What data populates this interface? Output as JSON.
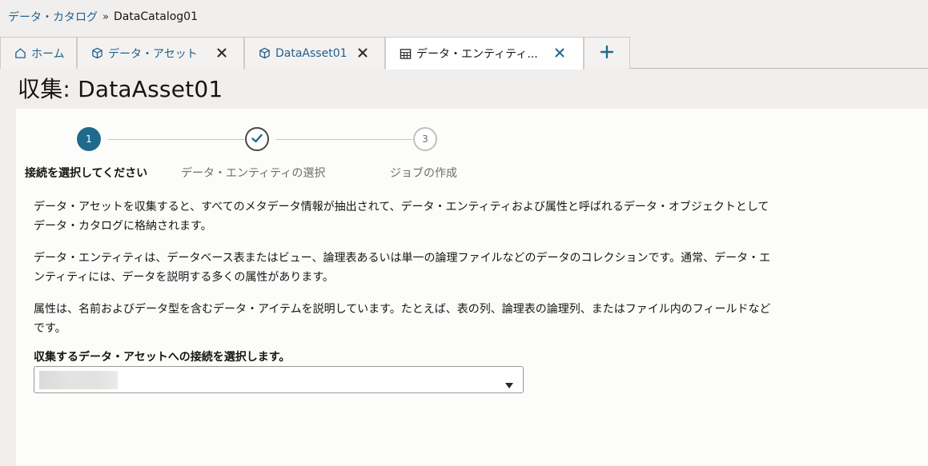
{
  "breadcrumb": {
    "parent": "データ・カタログ",
    "separator": "»",
    "current": "DataCatalog01"
  },
  "tabs": [
    {
      "label": "ホーム",
      "icon": "home-icon",
      "closable": false
    },
    {
      "label": "データ・アセット",
      "icon": "cube-icon",
      "closable": true
    },
    {
      "label": "DataAsset01",
      "icon": "cube-icon",
      "closable": true
    },
    {
      "label": "データ・エンティティ...",
      "icon": "table-icon",
      "closable": true,
      "active": true
    }
  ],
  "add_tab": {
    "icon": "plus-icon"
  },
  "page": {
    "title": "収集: DataAsset01"
  },
  "train": {
    "steps": [
      {
        "number": "1",
        "label": "接続を選択してください",
        "state": "current"
      },
      {
        "number": "",
        "label": "データ・エンティティの選択",
        "state": "done"
      },
      {
        "number": "3",
        "label": "ジョブの作成",
        "state": "todo"
      }
    ]
  },
  "description": {
    "paragraph1": "データ・アセットを収集すると、すべてのメタデータ情報が抽出されて、データ・エンティティおよび属性と呼ばれるデータ・オブジェクトとしてデータ・カタログに格納されます。",
    "paragraph2": "データ・エンティティは、データベース表またはビュー、論理表あるいは単一の論理ファイルなどのデータのコレクションです。通常、データ・エンティティには、データを説明する多くの属性があります。",
    "paragraph3": "属性は、名前およびデータ型を含むデータ・アイテムを説明しています。たとえば、表の列、論理表の論理列、またはファイル内のフィールドなどです。"
  },
  "connection": {
    "label": "収集するデータ・アセットへの接続を選択します。",
    "selected_value": ""
  },
  "colors": {
    "accent": "#1f6a8c",
    "link": "#1f5f8b",
    "background": "#f1efed",
    "panel": "#fcfcfb"
  }
}
